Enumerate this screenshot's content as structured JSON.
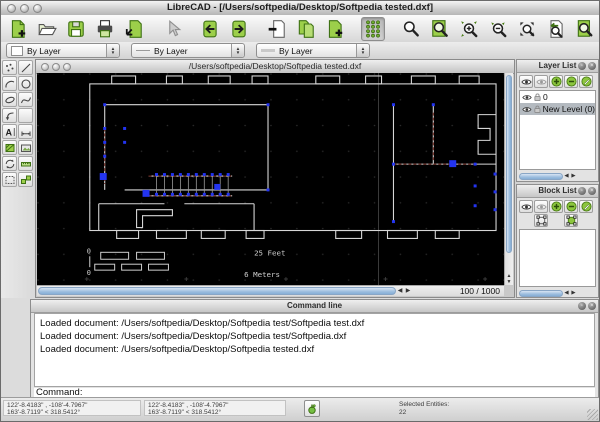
{
  "window": {
    "title": "LibreCAD - [/Users/softpedia/Desktop/Softpedia tested.dxf]"
  },
  "main_toolbar": {
    "buttons": [
      "new-file",
      "open-file",
      "save",
      "print",
      "print-preview",
      "pointer",
      "undo",
      "redo",
      "cut",
      "copy",
      "paste",
      "snap-grid",
      "zoom",
      "zoom-window",
      "zoom-in",
      "zoom-out",
      "zoom-auto",
      "zoom-previous",
      "zoom-page",
      "zoom-pan"
    ]
  },
  "options_toolbar": {
    "pen_color": "By Layer",
    "line_type": "By Layer",
    "line_width": "By Layer"
  },
  "tool_palette": {
    "tools": [
      "point",
      "line",
      "arc",
      "circle",
      "ellipse",
      "spline",
      "polyline",
      "",
      "text",
      "dimension",
      "hatch",
      "image",
      "modify",
      "measure",
      "select",
      "block"
    ]
  },
  "document": {
    "title": "/Users/softpedia/Desktop/Softpedia tested.dxf",
    "zoom_indicator": "100 / 1000",
    "scale_bar": {
      "zero_top": "0",
      "zero_bottom": "0",
      "feet_label": "25 Feet",
      "meters_label": "6 Meters"
    }
  },
  "layer_list": {
    "title": "Layer List",
    "layers": [
      {
        "name": "0"
      },
      {
        "name": "New Level (0)"
      }
    ]
  },
  "block_list": {
    "title": "Block List",
    "blocks": []
  },
  "command_panel": {
    "title": "Command line",
    "log": [
      "Loaded document: /Users/softpedia/Desktop/Softpedia test/Softpedia test.dxf",
      "Loaded document: /Users/softpedia/Desktop/Softpedia test/Softpedia.dxf",
      "Loaded document: /Users/softpedia/Desktop/Softpedia tested.dxf"
    ],
    "prompt_label": "Command:"
  },
  "status_bar": {
    "absolute_line1": "122'-8.4183\" , -108'-4.7967\"",
    "absolute_line2": "163'-8.7119\" < 318.5412°",
    "relative_line1": "122'-8.4183\" , -108'-4.7967\"",
    "relative_line2": "163'-8.7119\" < 318.5412°",
    "selected_entities_label": "Selected Entities:",
    "selected_entities_count": "22"
  },
  "colors": {
    "accent_green": "#8cc63e",
    "selection_blue": "#2334f0",
    "canvas_bg": "#000000"
  }
}
